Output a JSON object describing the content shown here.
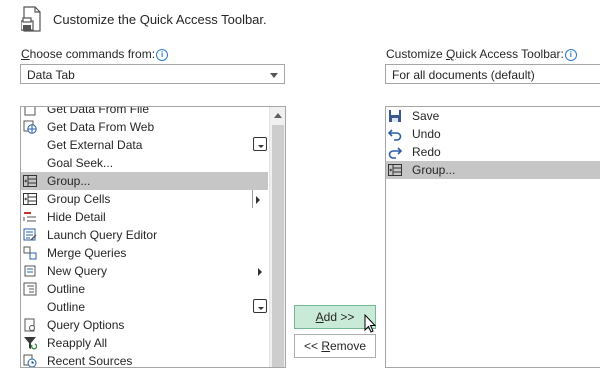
{
  "header": {
    "title": "Customize the Quick Access Toolbar."
  },
  "left": {
    "choose_label_pre": "",
    "choose_label_key": "C",
    "choose_label_rest": "hoose commands from:",
    "dropdown_value": "Data Tab",
    "commands": [
      {
        "label": "Get Data From File",
        "icon": "file-data-icon"
      },
      {
        "label": "Get Data From Web",
        "icon": "web-data-icon"
      },
      {
        "label": "Get External Data",
        "icon": "none"
      },
      {
        "label": "Goal Seek...",
        "icon": "none"
      },
      {
        "label": "Group...",
        "icon": "group-icon"
      },
      {
        "label": "Group Cells",
        "icon": "group-icon"
      },
      {
        "label": "Hide Detail",
        "icon": "hide-detail-icon"
      },
      {
        "label": "Launch Query Editor",
        "icon": "query-editor-icon"
      },
      {
        "label": "Merge Queries",
        "icon": "merge-queries-icon"
      },
      {
        "label": "New Query",
        "icon": "new-query-icon"
      },
      {
        "label": "Outline",
        "icon": "outline-icon"
      },
      {
        "label": "Outline",
        "icon": "none"
      },
      {
        "label": "Query Options",
        "icon": "query-options-icon"
      },
      {
        "label": "Reapply All",
        "icon": "reapply-icon"
      },
      {
        "label": "Recent Sources",
        "icon": "recent-sources-icon"
      }
    ],
    "selected_index": 4
  },
  "right": {
    "customize_label_pre": "Customize ",
    "customize_label_key": "Q",
    "customize_label_rest": "uick Access Toolbar:",
    "dropdown_value": "For all documents (default)",
    "items": [
      {
        "label": "Save",
        "icon": "save-icon"
      },
      {
        "label": "Undo",
        "icon": "undo-icon"
      },
      {
        "label": "Redo",
        "icon": "redo-icon"
      },
      {
        "label": "Group...",
        "icon": "group-icon"
      }
    ],
    "selected_index": 3
  },
  "buttons": {
    "add_key": "A",
    "add_rest": "dd >>",
    "remove_pre": "<< ",
    "remove_key": "R",
    "remove_rest": "emove"
  },
  "colors": {
    "selection": "#c6c6c6",
    "add_button_bg": "#c9ead6",
    "info_blue": "#2a7bd4"
  }
}
